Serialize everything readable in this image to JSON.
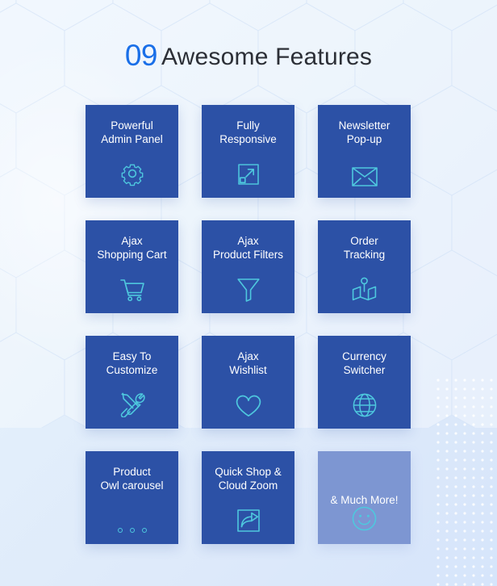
{
  "header": {
    "number": "09",
    "title": "Awesome Features",
    "number_color": "#1a6fe8",
    "title_color": "#2c2f36"
  },
  "theme": {
    "card_bg": "#2c51a6",
    "card_bg_muted": "#7d96d2",
    "icon_color": "#4ec8de",
    "page_bg": "#e4effb",
    "card_text": "#ffffff"
  },
  "features": [
    {
      "label": "Powerful\nAdmin Panel",
      "icon": "gear-icon",
      "muted": false
    },
    {
      "label": "Fully\nResponsive",
      "icon": "resize-arrow-icon",
      "muted": false
    },
    {
      "label": "Newsletter\nPop-up",
      "icon": "envelope-icon",
      "muted": false
    },
    {
      "label": "Ajax\nShopping Cart",
      "icon": "shopping-cart-icon",
      "muted": false
    },
    {
      "label": "Ajax\nProduct Filters",
      "icon": "funnel-icon",
      "muted": false
    },
    {
      "label": "Order\nTracking",
      "icon": "map-pin-icon",
      "muted": false
    },
    {
      "label": "Easy To\nCustomize",
      "icon": "tools-icon",
      "muted": false
    },
    {
      "label": "Ajax\nWishlist",
      "icon": "heart-icon",
      "muted": false
    },
    {
      "label": "Currency\nSwitcher",
      "icon": "globe-icon",
      "muted": false
    },
    {
      "label": "Product\nOwl carousel",
      "icon": "three-dots-icon",
      "muted": false
    },
    {
      "label": "Quick Shop &\nCloud Zoom",
      "icon": "share-arrow-icon",
      "muted": false
    },
    {
      "label": "& Much More!",
      "icon": "smiley-icon",
      "muted": true
    }
  ]
}
